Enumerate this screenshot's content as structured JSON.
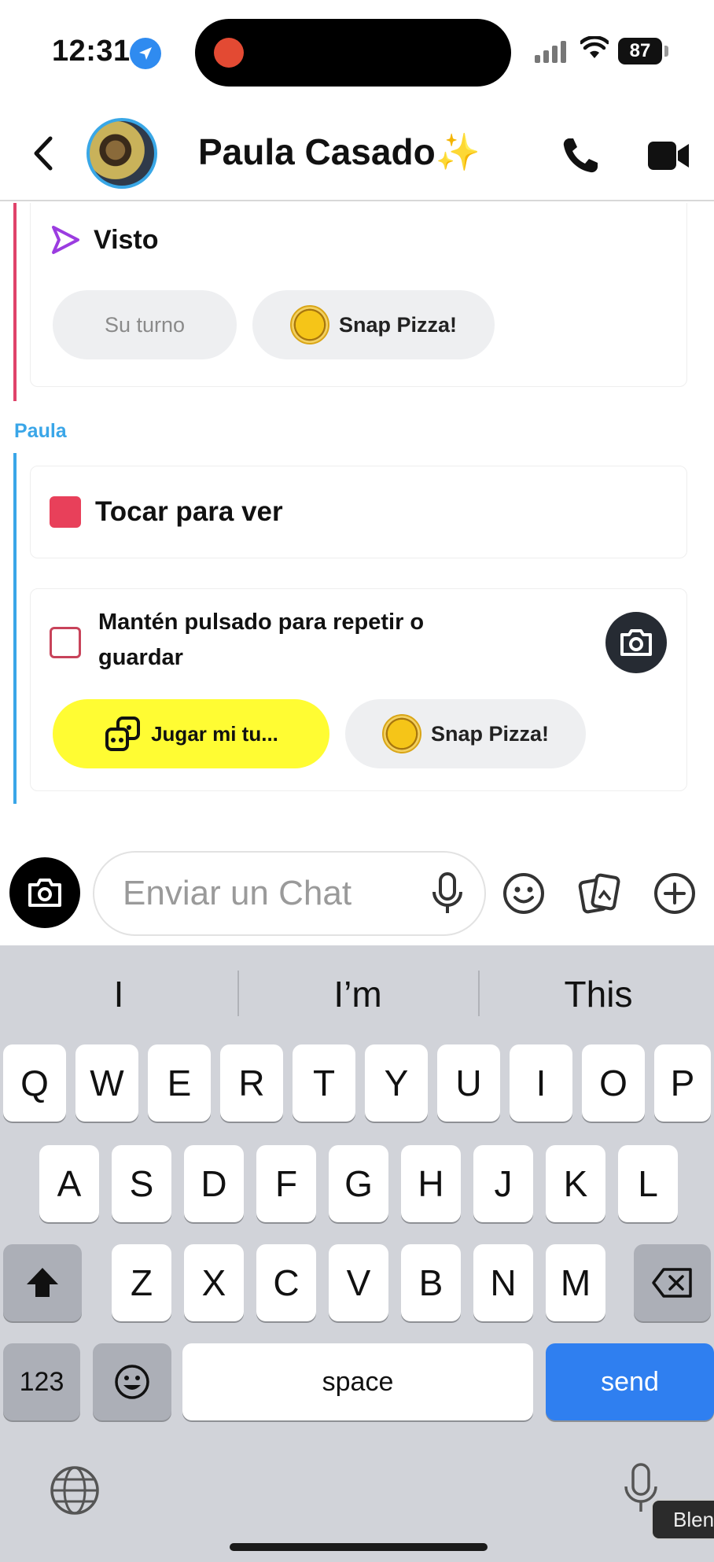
{
  "status_bar": {
    "time": "12:31",
    "battery": "87"
  },
  "header": {
    "contact_name": "Paula Casado✨"
  },
  "chat": {
    "card1": {
      "status": "Visto",
      "pill_turn": "Su turno",
      "pill_lens": "Snap Pizza!"
    },
    "sender": "Paula",
    "card2": {
      "text": "Tocar para ver"
    },
    "card3": {
      "text_line1": "Mantén pulsado para repetir o",
      "text_line2": "guardar",
      "play_button": "Jugar mi tu...",
      "pill_lens": "Snap Pizza!"
    }
  },
  "input": {
    "placeholder": "Enviar un Chat"
  },
  "keyboard": {
    "suggestions": [
      "I",
      "I’m",
      "This"
    ],
    "row1": [
      "Q",
      "W",
      "E",
      "R",
      "T",
      "Y",
      "U",
      "I",
      "O",
      "P"
    ],
    "row2": [
      "A",
      "S",
      "D",
      "F",
      "G",
      "H",
      "J",
      "K",
      "L"
    ],
    "row3": [
      "Z",
      "X",
      "C",
      "V",
      "B",
      "N",
      "M"
    ],
    "numbers_key": "123",
    "space_key": "space",
    "send_key": "send",
    "tooltip": "Blen"
  },
  "colors": {
    "accent_blue": "#3aa6e8",
    "accent_red": "#e0436a",
    "send_blue": "#2f7ff0",
    "play_yellow": "#fffc33"
  }
}
